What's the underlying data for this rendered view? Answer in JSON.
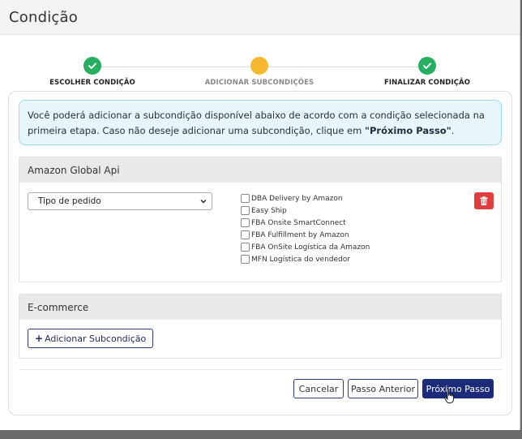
{
  "modal": {
    "title": "Condição"
  },
  "stepper": {
    "steps": [
      {
        "label": "ESCOLHER CONDIÇÃO",
        "state": "done"
      },
      {
        "label": "ADICIONAR SUBCONDIÇÕES",
        "state": "current"
      },
      {
        "label": "FINALIZAR CONDIÇÃO",
        "state": "done"
      }
    ]
  },
  "info": {
    "text": "Você poderá adicionar a subcondição disponível abaixo de acordo com a condição selecionada na primeira etapa. Caso não deseje adicionar uma subcondição, clique em ",
    "emphasis": "\"Próximo Passo\"",
    "suffix": "."
  },
  "sections": {
    "amazon": {
      "title": "Amazon Global Api",
      "select_value": "Tipo de pedido",
      "options": [
        {
          "label": "DBA Delivery by Amazon",
          "checked": false
        },
        {
          "label": "Easy Ship",
          "checked": false
        },
        {
          "label": "FBA Onsite SmartConnect",
          "checked": false
        },
        {
          "label": "FBA Fulfillment by Amazon",
          "checked": false
        },
        {
          "label": "FBA OnSite Logística da Amazon",
          "checked": false
        },
        {
          "label": "MFN Logística do vendedor",
          "checked": false
        }
      ]
    },
    "ecommerce": {
      "title": "E-commerce",
      "add_label": "Adicionar Subcondição"
    }
  },
  "footer": {
    "cancel_label": "Cancelar",
    "prev_label": "Passo Anterior",
    "next_label": "Próximo Passo"
  },
  "colors": {
    "done": "#27ae60",
    "current": "#f5b82e",
    "primary": "#1c2c7a",
    "danger": "#e23d3d",
    "info_bg": "#e7f6fb"
  },
  "icons": {
    "done": "check-icon",
    "delete": "trash-icon",
    "add": "plus-icon",
    "select": "chevron-down-icon"
  }
}
